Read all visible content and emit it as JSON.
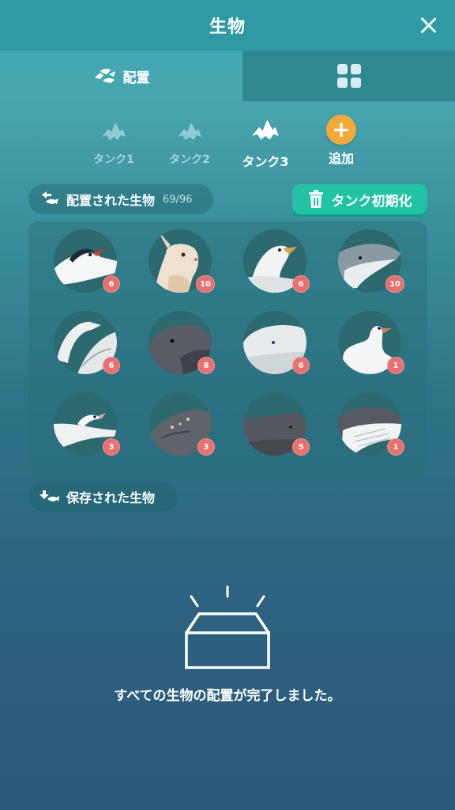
{
  "header": {
    "title": "生物"
  },
  "tabs": {
    "place_label": "配置"
  },
  "tanks": [
    {
      "label": "タンク1",
      "active": false
    },
    {
      "label": "タンク2",
      "active": false
    },
    {
      "label": "タンク3",
      "active": true
    }
  ],
  "add_tank_label": "追加",
  "placed_section": {
    "label": "配置された生物",
    "count": "69/96"
  },
  "reset_button": {
    "label": "タンク初期化"
  },
  "creatures": [
    {
      "icon": "tern-icon",
      "count": "6"
    },
    {
      "icon": "rabbit-icon",
      "count": "10"
    },
    {
      "icon": "gull-icon",
      "count": "6"
    },
    {
      "icon": "dolphin-icon",
      "count": "10"
    },
    {
      "icon": "seabird-icon",
      "count": "6"
    },
    {
      "icon": "pilot-whale-icon",
      "count": "8"
    },
    {
      "icon": "beluga-icon",
      "count": "6"
    },
    {
      "icon": "goose-icon",
      "count": "1"
    },
    {
      "icon": "albatross-icon",
      "count": "3"
    },
    {
      "icon": "gray-whale-icon",
      "count": "3"
    },
    {
      "icon": "sperm-whale-icon",
      "count": "5"
    },
    {
      "icon": "humpback-whale-icon",
      "count": "1"
    }
  ],
  "saved_section": {
    "label": "保存された生物"
  },
  "empty_message": "すべての生物の配置が完了しました。",
  "colors": {
    "accent_teal": "#22c3a5",
    "badge_red": "#e8716f",
    "add_orange": "#f3a93a",
    "header_bg": "#2f9aa3"
  }
}
